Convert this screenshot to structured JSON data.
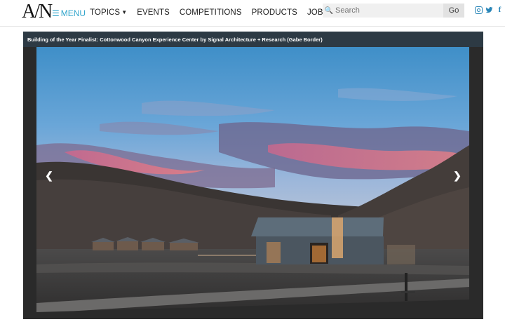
{
  "header": {
    "logo_text": "A/N",
    "menu_label": "MENU",
    "nav": [
      {
        "label": "TOPICS",
        "has_dropdown": true
      },
      {
        "label": "EVENTS",
        "has_dropdown": false
      },
      {
        "label": "COMPETITIONS",
        "has_dropdown": false
      },
      {
        "label": "PRODUCTS",
        "has_dropdown": false
      },
      {
        "label": "JOBS",
        "has_dropdown": false
      }
    ],
    "search": {
      "placeholder": "Search",
      "button_label": "Go",
      "icon": "search-icon"
    },
    "social": [
      "instagram-icon",
      "twitter-icon",
      "facebook-icon"
    ],
    "accent_color": "#33a6cc"
  },
  "gallery": {
    "caption": "Building of the Year Finalist: Cottonwood Canyon Experience Center by Signal Architecture + Research (Gabe Border)",
    "prev_icon": "chevron-left-icon",
    "next_icon": "chevron-right-icon",
    "caption_bg": "#2d3a44"
  }
}
